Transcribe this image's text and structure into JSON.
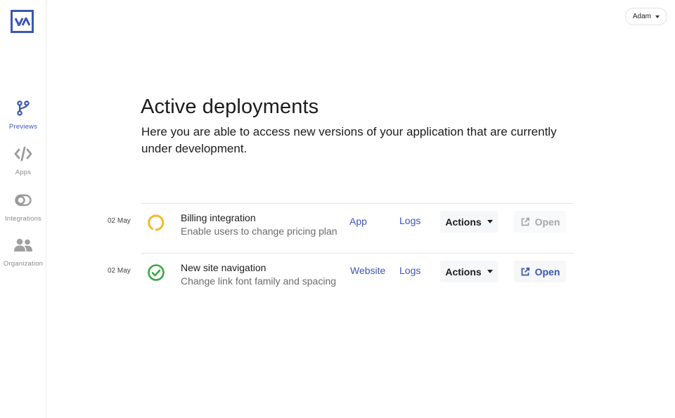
{
  "app": {
    "logo_text": "VA",
    "brand_color": "#3b56b4"
  },
  "user_menu": {
    "name": "Adam"
  },
  "sidebar": {
    "items": [
      {
        "label": "Previews",
        "icon": "branch-icon",
        "active": true
      },
      {
        "label": "Apps",
        "icon": "code-icon",
        "active": false
      },
      {
        "label": "Integrations",
        "icon": "toggle-icon",
        "active": false
      },
      {
        "label": "Organization",
        "icon": "users-icon",
        "active": false
      }
    ]
  },
  "main": {
    "title": "Active deployments",
    "description": "Here you are able to access new versions of your application that are currently under development."
  },
  "deployments": [
    {
      "date": "02 May",
      "status": "in-progress",
      "status_color": "#f5b82e",
      "title": "Billing integration",
      "subtitle": "Enable users to change pricing plan",
      "env_link": "App",
      "logs_link": "Logs",
      "actions_label": "Actions",
      "open_label": "Open",
      "open_enabled": false
    },
    {
      "date": "02 May",
      "status": "success",
      "status_color": "#3aa845",
      "title": "New site navigation",
      "subtitle": "Change link font family and spacing",
      "env_link": "Website",
      "logs_link": "Logs",
      "actions_label": "Actions",
      "open_label": "Open",
      "open_enabled": true
    }
  ]
}
